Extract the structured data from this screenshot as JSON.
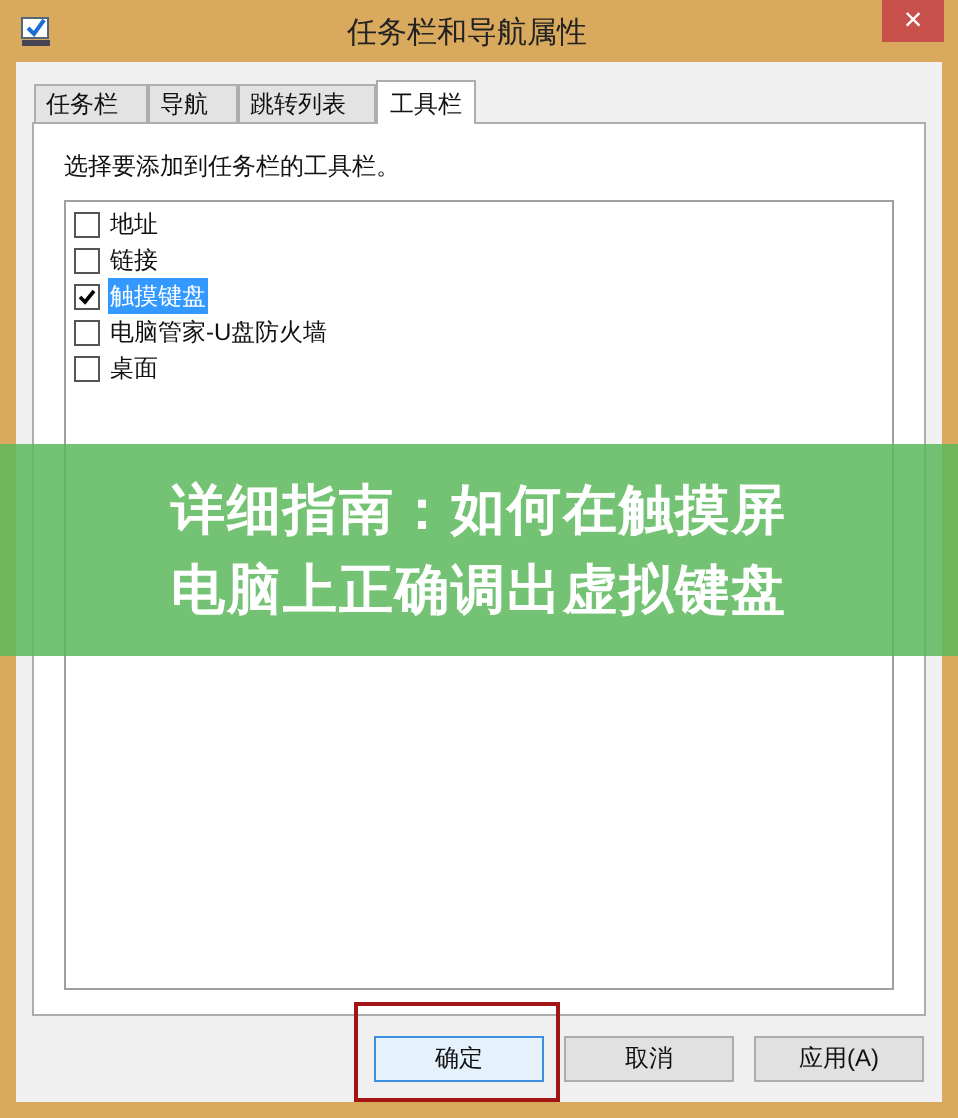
{
  "window": {
    "title": "任务栏和导航属性",
    "close": "×"
  },
  "tabs": [
    {
      "label": "任务栏",
      "selected": false
    },
    {
      "label": "导航",
      "selected": false
    },
    {
      "label": "跳转列表",
      "selected": false
    },
    {
      "label": "工具栏",
      "selected": true
    }
  ],
  "instruction": "选择要添加到任务栏的工具栏。",
  "toolbars": [
    {
      "label": "地址",
      "checked": false,
      "selected": false
    },
    {
      "label": "链接",
      "checked": false,
      "selected": false
    },
    {
      "label": "触摸键盘",
      "checked": true,
      "selected": true
    },
    {
      "label": "电脑管家-U盘防火墙",
      "checked": false,
      "selected": false
    },
    {
      "label": "桌面",
      "checked": false,
      "selected": false
    }
  ],
  "buttons": [
    {
      "label": "确定",
      "highlighted": true
    },
    {
      "label": "取消",
      "highlighted": false
    },
    {
      "label": "应用(A)",
      "highlighted": false
    }
  ],
  "banner": {
    "lines": [
      "详细指南：如何在触摸屏",
      "电脑上正确调出虚拟键盘"
    ]
  }
}
